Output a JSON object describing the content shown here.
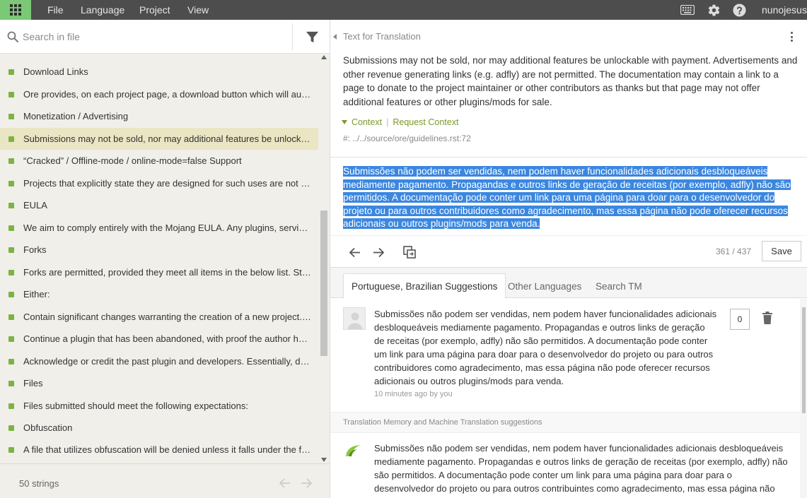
{
  "topbar": {
    "menu": [
      "File",
      "Language",
      "Project",
      "View"
    ],
    "username": "nunojesus",
    "icons": [
      "apps-icon",
      "keyboard-icon",
      "gear-icon",
      "help-icon"
    ]
  },
  "left": {
    "search_placeholder": "Search in file",
    "items": [
      {
        "text": "Download Links",
        "status": "translated"
      },
      {
        "text": "Ore provides, on each project page, a download button which will automatically download the latest file",
        "status": "translated"
      },
      {
        "text": "Monetization / Advertising",
        "status": "translated"
      },
      {
        "text": "Submissions may not be sold, nor may additional features be unlockable with payment",
        "status": "translated",
        "selected": true
      },
      {
        "text": "“Cracked” / Offline-mode / online-mode=false Support",
        "status": "translated"
      },
      {
        "text": "Projects that explicitly state they are designed for such uses are not allowed",
        "status": "translated"
      },
      {
        "text": "EULA",
        "status": "translated"
      },
      {
        "text": "We aim to comply entirely with the Mojang EULA. Any plugins, services, projects",
        "status": "translated"
      },
      {
        "text": "Forks",
        "status": "translated"
      },
      {
        "text": "Forks are permitted, provided they meet all items in the below list. Staff members",
        "status": "translated"
      },
      {
        "text": "Either:",
        "status": "translated"
      },
      {
        "text": "Contain significant changes warranting the creation of a new project. This is",
        "status": "translated"
      },
      {
        "text": "Continue a plugin that has been abandoned, with proof the author has no",
        "status": "translated"
      },
      {
        "text": "Acknowledge or credit the past plugin and developers. Essentially, don’t steal",
        "status": "translated"
      },
      {
        "text": "Files",
        "status": "translated"
      },
      {
        "text": "Files submitted should meet the following expectations:",
        "status": "translated"
      },
      {
        "text": "Obfuscation",
        "status": "translated"
      },
      {
        "text": "A file that utilizes obfuscation will be denied unless it falls under the following",
        "status": "translated"
      }
    ],
    "strings_count": "50 strings"
  },
  "editor": {
    "source_header": "Text for Translation",
    "source_text": "Submissions may not be sold, nor may additional features be unlockable with payment. Advertisements and other revenue generating links (e.g. adfly) are not permitted. The documentation may contain a link to a page to donate to the project maintainer or other contributors as thanks but that page may not offer additional features or other plugins/mods for sale.",
    "context_label": "Context",
    "request_context_label": "Request Context",
    "file_ref": "#: ../../source/ore/guidelines.rst:72",
    "translation": "Submissões não podem ser vendidas, nem podem haver funcionalidades adicionais desbloqueáveis mediamente pagamento. Propagandas e outros links de geração de receitas (por exemplo, adfly) não são permitidos. A documentação pode conter um link para uma página para doar para o desenvolvedor do projeto ou para outros contribuidores como agradecimento, mas essa página não pode oferecer recursos adicionais ou outros plugins/mods para venda.",
    "char_count": "361 / 437",
    "save_label": "Save"
  },
  "tabs": [
    "Portuguese, Brazilian Suggestions",
    "Other Languages",
    "Search TM"
  ],
  "suggestion": {
    "text": "Submissões não podem ser vendidas, nem podem haver funcionalidades adicionais desbloqueáveis mediamente pagamento. Propagandas e outros links de geração de receitas (por exemplo, adfly) não são permitidos. A documentação pode conter um link para uma página para doar para o desenvolvedor do projeto ou para outros contribuidores como agradecimento, mas essa página não pode oferecer recursos adicionais ou outros plugins/mods para venda.",
    "meta": "10 minutes ago by you",
    "votes": "0"
  },
  "tm": {
    "header": "Translation Memory and Machine Translation suggestions",
    "text": "Submissões não podem ser vendidas, nem podem haver funcionalidades adicionais desbloqueáveis mediamente pagamento. Propagandas e outros links de geração de receitas (por exemplo, adfly) não são permitidos. A documentação pode conter um link para uma página para doar para o desenvolvedor do projeto ou para outros contribuintes como agradecimento, mas essa página não pode oferecer recursos adicionais ou outros plugins/mods para venda."
  },
  "colors": {
    "topbar": "#4d4d4d",
    "accent_green": "#7bc876",
    "status_dot": "#7cb342",
    "selected_row": "#eae5c3",
    "translation_highlight": "#3b87e0"
  }
}
